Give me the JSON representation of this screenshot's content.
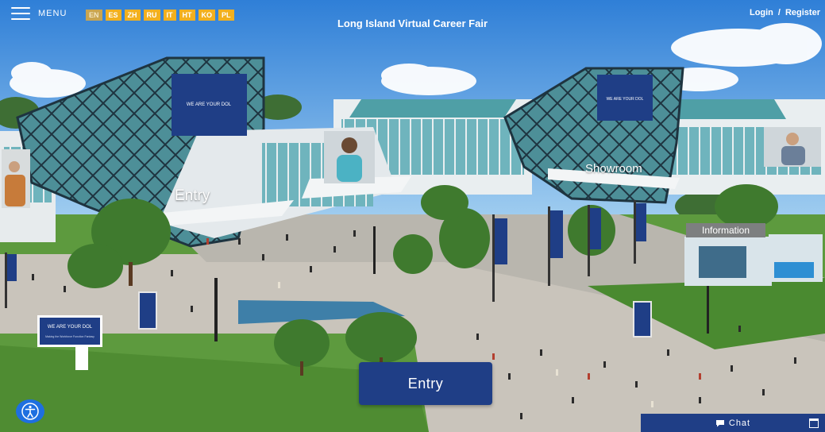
{
  "header": {
    "menu_label": "MENU",
    "languages": [
      "EN",
      "ES",
      "ZH",
      "RU",
      "IT",
      "HT",
      "KO",
      "PL"
    ],
    "active_language": "EN",
    "title": "Long Island Virtual Career Fair",
    "login": "Login",
    "separator": "/",
    "register": "Register"
  },
  "scene": {
    "entry_sign": "Entry",
    "showroom_sign": "Showroom",
    "information_sign": "Information",
    "banner_text": "WE ARE YOUR DOL",
    "banner_kiosk_subtext": "Making the Workforce Function Fantasy"
  },
  "actions": {
    "entry_button": "Entry",
    "chat": "Chat"
  },
  "colors": {
    "brand_blue": "#1f3e86",
    "lang_yellow": "#f2b01e",
    "accessibility_blue": "#1e6fe0"
  }
}
